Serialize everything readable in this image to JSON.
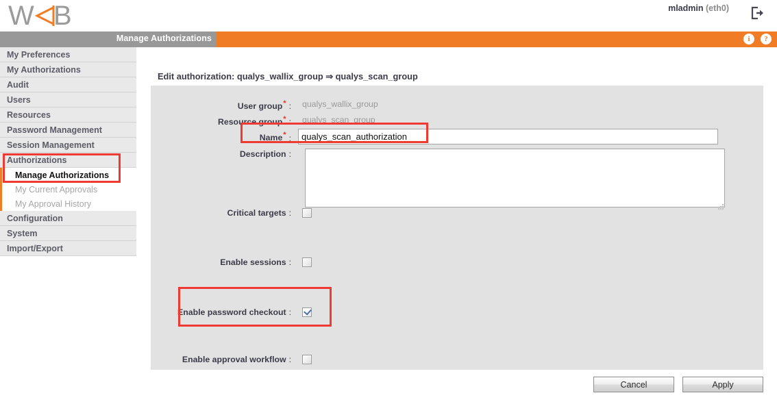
{
  "header": {
    "logo_text_left": "W",
    "logo_text_right": "B",
    "logo_icon": "orange-triangle-arrow",
    "user_name": "mladmin",
    "user_interface": "(eth0)",
    "logout_icon": "logout-icon"
  },
  "titlebar": {
    "title": "Manage Authorizations",
    "info_icon": "i",
    "help_icon": "?"
  },
  "sidebar": {
    "items": [
      {
        "label": "My Preferences"
      },
      {
        "label": "My Authorizations"
      },
      {
        "label": "Audit"
      },
      {
        "label": "Users"
      },
      {
        "label": "Resources"
      },
      {
        "label": "Password Management"
      },
      {
        "label": "Session Management"
      },
      {
        "label": "Authorizations"
      },
      {
        "label": "Configuration"
      },
      {
        "label": "System"
      },
      {
        "label": "Import/Export"
      }
    ],
    "sub_items": [
      {
        "label": "Manage Authorizations",
        "active": true
      },
      {
        "label": "My Current Approvals",
        "active": false
      },
      {
        "label": "My Approval History",
        "active": false
      }
    ]
  },
  "main": {
    "page_title": "Edit authorization: qualys_wallix_group ⇒ qualys_scan_group",
    "fields": {
      "user_group_label": "User group",
      "user_group_value": "qualys_wallix_group",
      "resource_group_label": "Resource group",
      "resource_group_value": "qualys_scan_group",
      "name_label": "Name",
      "name_value": "qualys_scan_authorization",
      "description_label": "Description",
      "description_value": "",
      "critical_targets_label": "Critical targets",
      "critical_targets_checked": false,
      "enable_sessions_label": "Enable sessions",
      "enable_sessions_checked": false,
      "enable_password_checkout_label": "Enable password checkout",
      "enable_password_checkout_checked": true,
      "enable_approval_workflow_label": "Enable approval workflow",
      "enable_approval_workflow_checked": false
    },
    "required_marker": "*",
    "colon": ":"
  },
  "footer": {
    "cancel_label": "Cancel",
    "apply_label": "Apply"
  },
  "colors": {
    "accent_orange": "#f07d26",
    "titlebar_grey": "#989898",
    "highlight_red": "#ee3a32",
    "panel_grey": "#e2e2e2",
    "nav_grey": "#e9e9e9"
  }
}
